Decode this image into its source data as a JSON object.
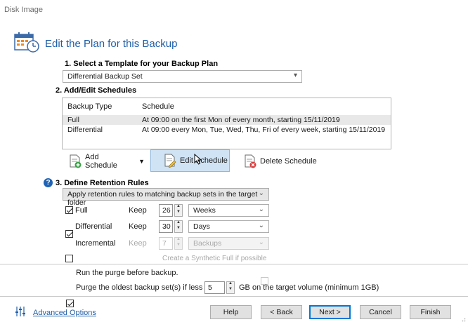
{
  "window": {
    "title": "Disk Image"
  },
  "header": {
    "title": "Edit the Plan for this Backup",
    "icon": "calendar-clock-icon"
  },
  "template_section": {
    "label": "1. Select a Template for your Backup Plan",
    "selected": "Differential Backup Set"
  },
  "schedules_section": {
    "label": "2. Add/Edit Schedules",
    "columns": [
      "Backup Type",
      "Schedule"
    ],
    "rows": [
      {
        "type": "Full",
        "schedule": "At 09:00 on the first Mon of every month, starting 15/11/2019",
        "selected": true
      },
      {
        "type": "Differential",
        "schedule": "At 09:00 every Mon, Tue, Wed, Thu, Fri of every week, starting 15/11/2019",
        "selected": false
      }
    ],
    "actions": {
      "add": "Add Schedule",
      "edit": "Edit Schedule",
      "delete": "Delete Schedule"
    }
  },
  "retention_section": {
    "label": "3. Define Retention Rules",
    "mode": "Apply retention rules to matching backup sets in the target folder",
    "keep_label": "Keep",
    "rules": [
      {
        "name": "Full",
        "checked": true,
        "enabled": true,
        "value": "26",
        "unit": "Weeks"
      },
      {
        "name": "Differential",
        "checked": true,
        "enabled": true,
        "value": "30",
        "unit": "Days"
      },
      {
        "name": "Incremental",
        "checked": false,
        "enabled": false,
        "value": "7",
        "unit": "Backups"
      }
    ],
    "synthetic_full": "Create a Synthetic Full if possible"
  },
  "purge": {
    "run_before": "Run the purge before backup.",
    "oldest_label": "Purge the oldest backup set(s) if less than",
    "oldest_value": "5",
    "oldest_suffix": "GB on the target volume (minimum 1GB)"
  },
  "footer": {
    "advanced": "Advanced Options",
    "help": "Help",
    "back": "< Back",
    "next": "Next >",
    "cancel": "Cancel",
    "finish": "Finish"
  },
  "colors": {
    "accent": "#1f5fa8",
    "selected_button": "#cfe3f5",
    "primary_border": "#0078d7"
  }
}
